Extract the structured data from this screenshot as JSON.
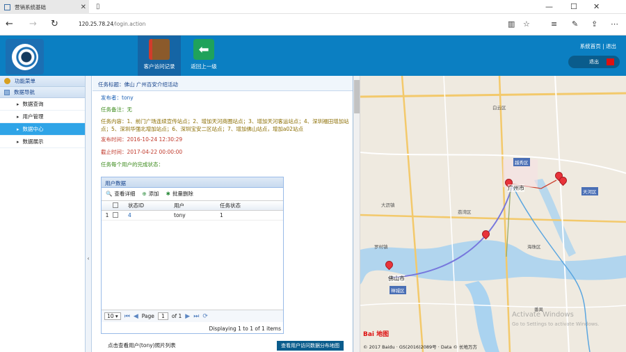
{
  "browser": {
    "tab_title": "营销系统基础",
    "url_host": "120.25.78.24",
    "url_path": "/login.action"
  },
  "header": {
    "visit_button": "客户访问记录",
    "back_button": "返回上一级",
    "links": "系统首页 | 退出",
    "logout": "退出"
  },
  "sidebar": {
    "menu_title": "功能菜单",
    "section_title": "数据导航",
    "items": [
      {
        "label": "数据查询"
      },
      {
        "label": "用户管理"
      },
      {
        "label": "数据中心"
      },
      {
        "label": "数据展示"
      }
    ]
  },
  "task": {
    "title": "任务标题：佛山 广州百安介绍活动",
    "publisher": "发布者：tony",
    "remark": "任务备注：无",
    "content": "任务内容：1、前门广场连续宣传站点；2、增加天河商圈站点；3、增加天河客运站点；4、深圳福田增加站点；5、深圳华强北增加站点；6、深圳宝安二区站点；7、增加佛山站点，增加a02站点",
    "published_time": "发布时间：2016-10-24 12:30:29",
    "end_time": "截止时间：2017-04-22 00:00:00",
    "users_status": "任务每个用户的完成状态："
  },
  "grid": {
    "title": "用户数据",
    "tools": [
      "查看详细",
      "添加",
      "批量删除"
    ],
    "columns": [
      "状态ID",
      "用户",
      "任务状态"
    ],
    "rows": [
      {
        "index": "1",
        "status_id": "4",
        "user": "tony",
        "task_status": "1"
      }
    ],
    "pager": {
      "page_size": "10",
      "page_label": "Page",
      "page_value": "1",
      "of_label": "of 1",
      "display": "Displaying 1 to 1 of 1 items"
    }
  },
  "photo_list": "点击查看用户(tony)照片列表",
  "tooltip": "查看用户访问数据分布地图",
  "map": {
    "labels": {
      "guangzhou": "广州市",
      "tianhe": "天河区",
      "foshan": "佛山市",
      "chancheng": "禅城区",
      "yuexiu": "越秀区",
      "baiyun": "白云区",
      "liwan": "荔湾区",
      "haizhu": "海珠区",
      "panyu": "番禺",
      "dali": "大沥镇",
      "luocun": "罗村镇"
    },
    "copyright": "© 2017 Baidu · GS(2016)2089号 · Data © 长地万方",
    "logo": "Bai 地图",
    "watermark": "Activate Windows",
    "watermark_sub": "Go to Settings to activate Windows."
  },
  "colors": {
    "header_blue": "#0b7fc2",
    "active_item": "#2fa4e7",
    "pin": "#e8333a"
  }
}
